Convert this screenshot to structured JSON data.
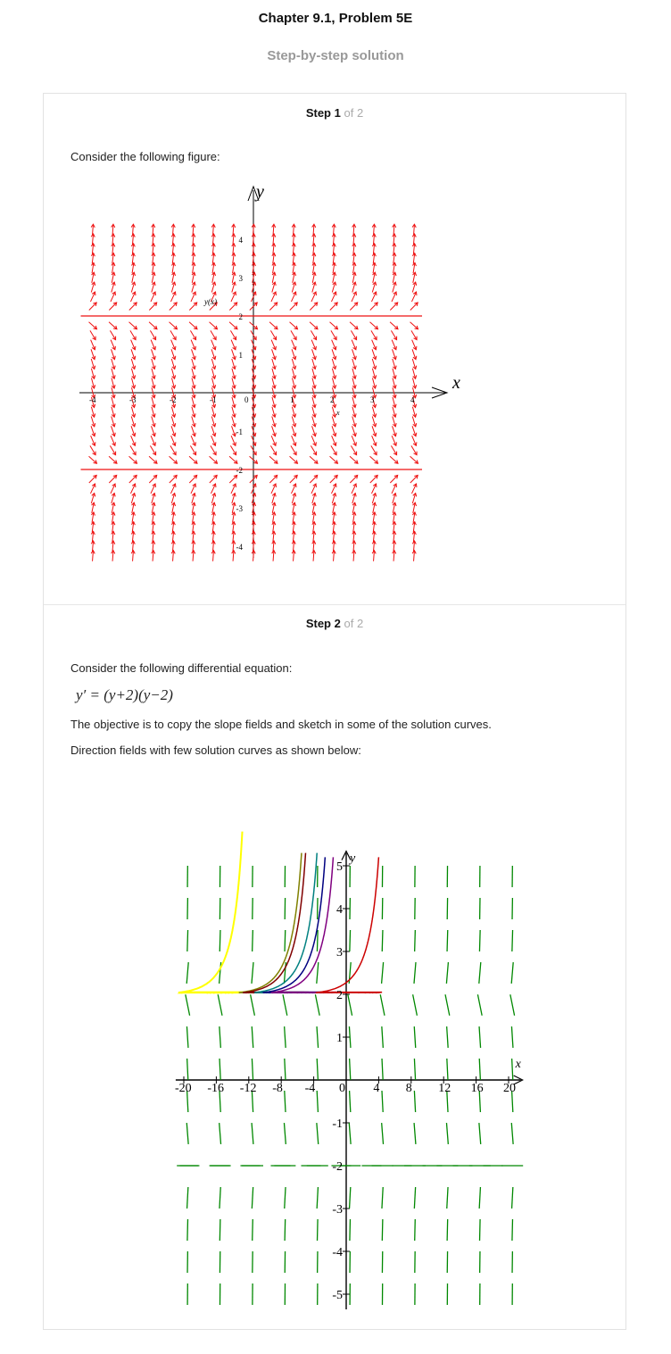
{
  "header": {
    "title": "Chapter 9.1, Problem 5E",
    "subtitle": "Step-by-step solution"
  },
  "steps": [
    {
      "label": "Step",
      "number": "1",
      "of_text": "of 2",
      "text": "Consider the following figure:",
      "figure": {
        "x_axis_label": "x",
        "y_axis_label": "y",
        "curve_label": "y(x)",
        "x_small_label": "x",
        "x_ticks": [
          "-4",
          "-3",
          "-2",
          "-1",
          "0",
          "1",
          "2",
          "3",
          "4"
        ],
        "y_ticks": [
          "4",
          "3",
          "2",
          "1",
          "-1",
          "-2",
          "-3",
          "-4"
        ],
        "arrow_color": "#ee1111"
      }
    },
    {
      "label": "Step",
      "number": "2",
      "of_text": "of 2",
      "intro": "Consider the following differential equation:",
      "equation": "y′ = (y+2)(y−2)",
      "objective": "The objective is to copy the slope fields and sketch in some of the solution curves.",
      "caption": "Direction fields with few solution curves as shown below:",
      "figure": {
        "x_axis_label": "x",
        "y_axis_label": "y",
        "x_ticks": [
          "-20",
          "-16",
          "-12",
          "-8",
          "-4",
          "0",
          "4",
          "8",
          "12",
          "16",
          "20"
        ],
        "y_ticks": [
          "5",
          "4",
          "3",
          "2",
          "1",
          "-1",
          "-2",
          "-3",
          "-4",
          "-5"
        ],
        "field_color": "#008800",
        "curve_colors": [
          "#ffff00",
          "#808000",
          "#800000",
          "#008080",
          "#000080",
          "#800080",
          "#cc0000"
        ]
      }
    }
  ]
}
